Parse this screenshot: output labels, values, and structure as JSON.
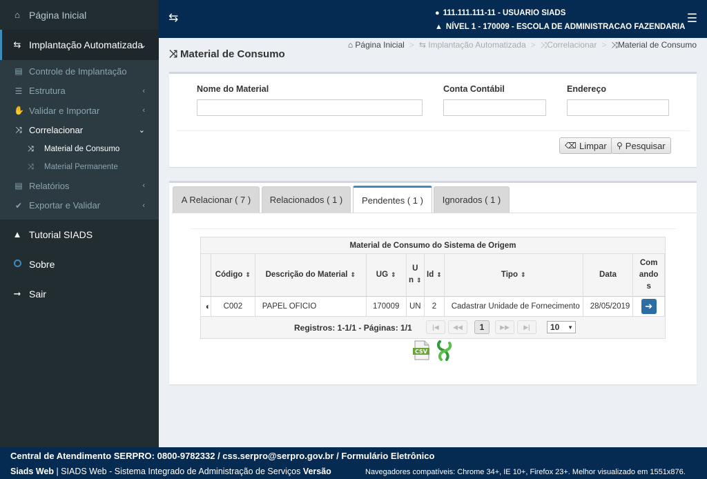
{
  "sidebar": {
    "home": "Página Inicial",
    "implantacao": "Implantação Automatizada",
    "controle": "Controle de Implantação",
    "estrutura": "Estrutura",
    "validar": "Validar e Importar",
    "correlacionar": "Correlacionar",
    "material_consumo": "Material de Consumo",
    "material_permanente": "Material Permanente",
    "relatorios": "Relatórios",
    "exportar": "Exportar e Validar",
    "tutorial": "Tutorial SIADS",
    "sobre": "Sobre",
    "sair": "Sair"
  },
  "header": {
    "user": "111.111.111-11 - USUARIO SIADS",
    "level": "NÍVEL 1 - 170009 - ESCOLA DE ADMINISTRACAO FAZENDARIA"
  },
  "page": {
    "title": "Material de Consumo",
    "breadcrumb": [
      "Página Inicial",
      "Implantação Automatizada",
      "Correlacionar",
      "Material de Consumo"
    ]
  },
  "search": {
    "nome_label": "Nome do Material",
    "nome_value": "",
    "conta_label": "Conta Contábil",
    "conta_value": "",
    "endereco_label": "Endereço",
    "endereco_value": "",
    "limpar": "Limpar",
    "pesquisar": "Pesquisar"
  },
  "tabs": [
    {
      "label": "A Relacionar ( 7 )"
    },
    {
      "label": "Relacionados ( 1 )"
    },
    {
      "label": "Pendentes ( 1 )"
    },
    {
      "label": "Ignorados ( 1 )"
    }
  ],
  "grid": {
    "caption": "Material de Consumo do Sistema de Origem",
    "headers": {
      "codigo": "Código",
      "descricao": "Descrição do Material",
      "ug": "UG",
      "un_a": "U",
      "un_b": "n",
      "id": "Id",
      "tipo": "Tipo",
      "data": "Data",
      "cmd_a": "Com",
      "cmd_b": "ando",
      "cmd_c": "s"
    },
    "rows": [
      {
        "codigo": "C002",
        "descricao": "PAPEL OFICIO",
        "ug": "170009",
        "un": "UN",
        "id": "2",
        "tipo": "Cadastrar Unidade de Fornecimento",
        "data": "28/05/2019"
      }
    ],
    "registros": "Registros: 1-1/1 - Páginas: 1/1",
    "current_page": "1",
    "page_size": "10",
    "csv_label": "CSV"
  },
  "footer": {
    "line1": "Central de Atendimento SERPRO: 0800-9782332 / css.serpro@serpro.gov.br / Formulário Eletrônico",
    "app": "Siads Web",
    "desc": " | SIADS Web - Sistema Integrado de Administração de Serviços ",
    "versao": "Versão",
    "browsers": "Navegadores compatíveis: Chrome 34+, IE 10+, Firefox 23+. Melhor visualizado em 1551x876."
  },
  "colors": {
    "header_bg": "#062b52",
    "sidebar_bg": "#222d32",
    "accent": "#3c8dbc"
  }
}
